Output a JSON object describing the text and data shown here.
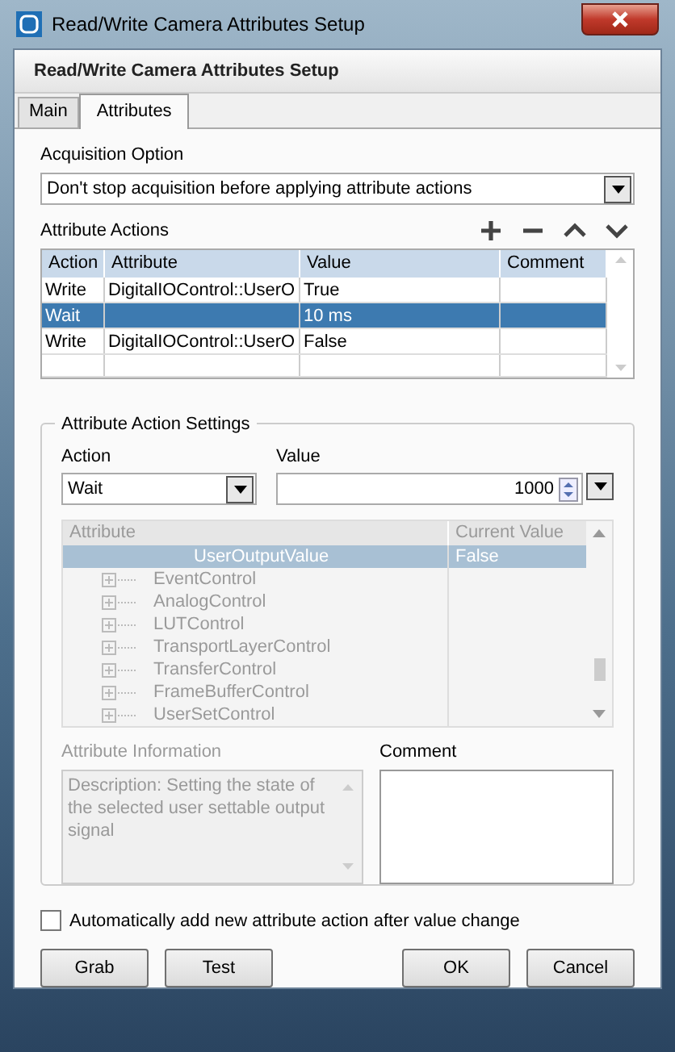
{
  "window": {
    "title": "Read/Write Camera Attributes Setup"
  },
  "header": "Read/Write Camera Attributes Setup",
  "tabs": [
    {
      "label": "Main",
      "selected": false
    },
    {
      "label": "Attributes",
      "selected": true
    }
  ],
  "acquisition": {
    "label": "Acquisition Option",
    "value": "Don't stop acquisition before applying attribute actions"
  },
  "actions": {
    "label": "Attribute Actions",
    "columns": [
      "Action",
      "Attribute",
      "Value",
      "Comment"
    ],
    "rows": [
      {
        "action": "Write",
        "attribute": "DigitalIOControl::UserO",
        "value": "True",
        "selected": false
      },
      {
        "action": "Wait",
        "value": "10 ms",
        "selected": true
      },
      {
        "action": "Write",
        "attribute": "DigitalIOControl::UserO",
        "value": "False",
        "selected": false
      }
    ]
  },
  "settings": {
    "title": "Attribute Action Settings",
    "action_label": "Action",
    "action_value": "Wait",
    "value_label": "Value",
    "value": "1000",
    "tree": {
      "disabled": true,
      "columns": [
        "Attribute",
        "Current Value"
      ],
      "rows": [
        {
          "name": "UserOutputValue",
          "value": "False",
          "expandable": false,
          "selected": true
        },
        {
          "name": "EventControl",
          "expandable": true,
          "selected": false
        },
        {
          "name": "AnalogControl",
          "expandable": true,
          "selected": false
        },
        {
          "name": "LUTControl",
          "expandable": true,
          "selected": false
        },
        {
          "name": "TransportLayerControl",
          "expandable": true,
          "selected": false
        },
        {
          "name": "TransferControl",
          "expandable": true,
          "selected": false
        },
        {
          "name": "FrameBufferControl",
          "expandable": true,
          "selected": false
        },
        {
          "name": "UserSetControl",
          "expandable": true,
          "selected": false
        }
      ]
    },
    "info": {
      "label": "Attribute Information",
      "text": "Description: Setting the state of the selected user settable output signal",
      "disabled": true
    },
    "comment_label": "Comment"
  },
  "auto_add": {
    "label": "Automatically add new attribute action after value change",
    "checked": false
  },
  "buttons": [
    "Grab",
    "Test",
    "OK",
    "Cancel"
  ]
}
